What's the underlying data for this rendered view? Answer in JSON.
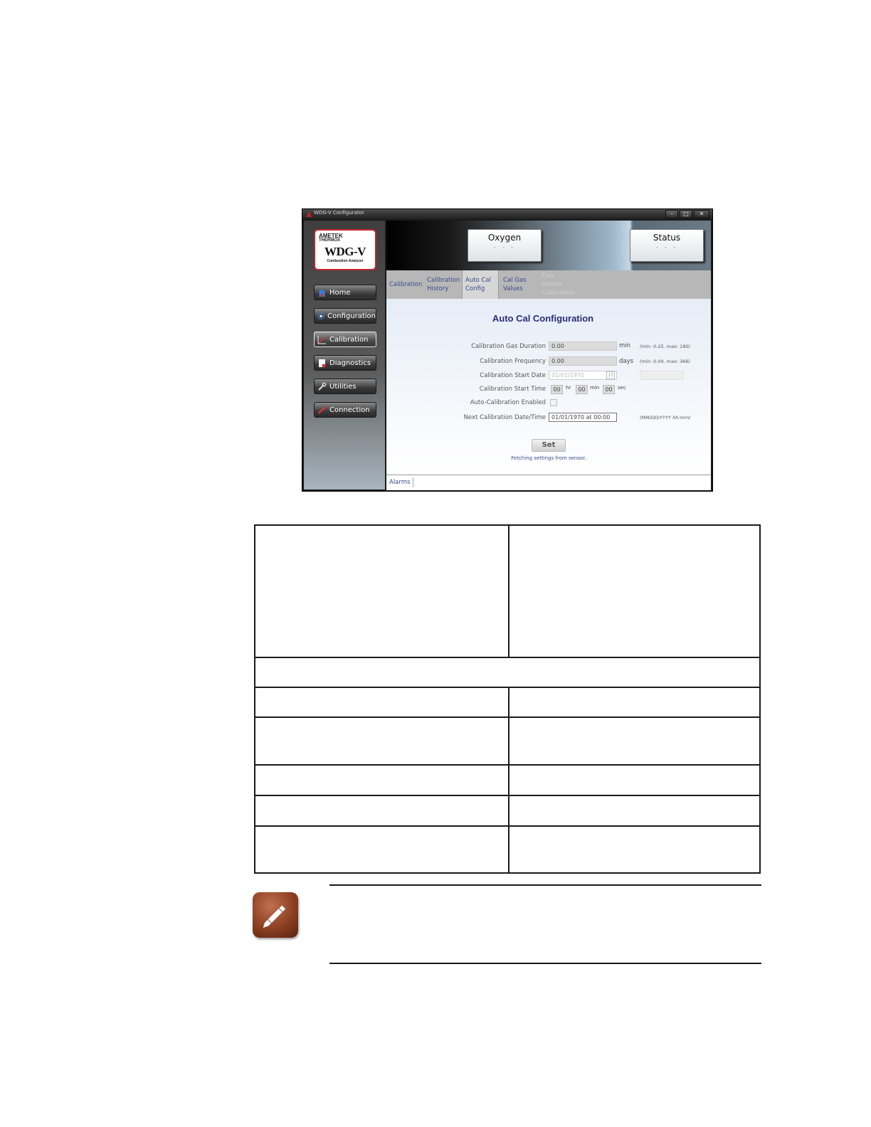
{
  "window": {
    "title": "WDG-V Configurator",
    "controls": {
      "minimize": "–",
      "maximize": "□",
      "close": "✕"
    }
  },
  "logo": {
    "brand": "AMETEK",
    "sub_brand": "THERMOX",
    "product": "WDG-V",
    "tagline": "Combustion Analyzer"
  },
  "nav": [
    {
      "label": "Home",
      "icon": "house-icon"
    },
    {
      "label": "Configuration",
      "icon": "gear-icon"
    },
    {
      "label": "Calibration",
      "icon": "calibration-icon"
    },
    {
      "label": "Diagnostics",
      "icon": "document-icon"
    },
    {
      "label": "Utilities",
      "icon": "wrench-icon"
    },
    {
      "label": "Connection",
      "icon": "connection-icon"
    }
  ],
  "header": {
    "oxygen": {
      "title": "Oxygen",
      "value": "- - -"
    },
    "status": {
      "title": "Status",
      "value": "- - -"
    }
  },
  "tabs": [
    {
      "label": "Calibration",
      "state": "normal"
    },
    {
      "label": "Calibration History",
      "state": "normal"
    },
    {
      "label": "Auto Cal Config",
      "state": "selected"
    },
    {
      "label": "Cal Gas Values",
      "state": "normal"
    },
    {
      "label": "Flex Sensor Calibration",
      "state": "disabled"
    }
  ],
  "form": {
    "title": "Auto Cal Configuration",
    "gas_duration": {
      "label": "Calibration Gas Duration",
      "value": "0.00",
      "unit": "min",
      "hint": "(min: 0.25, max: 180)"
    },
    "frequency": {
      "label": "Calibration Frequency",
      "value": "0.00",
      "unit": "days",
      "hint": "(min: 0.04, max: 366)"
    },
    "start_date": {
      "label": "Calibration Start Date",
      "value": "01/01/1970",
      "picker": "15"
    },
    "start_time": {
      "label": "Calibration Start Time",
      "hr": "00",
      "hr_unit": "hr",
      "min": "00",
      "min_unit": "min",
      "sec": "00",
      "sec_unit": "sec"
    },
    "enabled": {
      "label": "Auto-Calibration Enabled"
    },
    "next": {
      "label": "Next Calibration Date/Time",
      "value": "01/01/1970 at 00:00",
      "hint": "(MM/DD/YYYY hh:mm)"
    },
    "set_label": "Set",
    "status_text": "Fetching settings from sensor."
  },
  "statusbar": {
    "alarms": "Alarms"
  },
  "colors": {
    "accent_text": "#2c2c7a",
    "tab_text": "#3a4a8a",
    "logo_border": "#c0252a",
    "note_icon": "#8c3f22"
  }
}
